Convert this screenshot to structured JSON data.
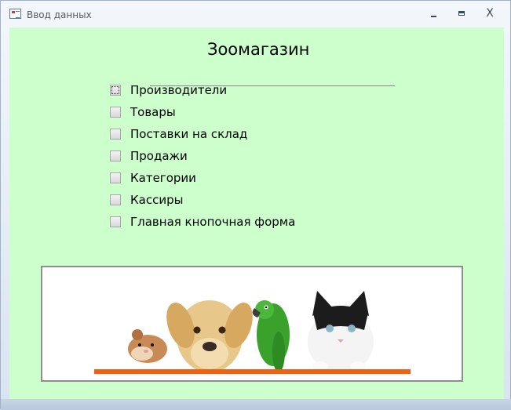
{
  "window": {
    "title": "Ввод данных",
    "minimize_glyph": "minimize-icon",
    "maximize_glyph": "maximize-icon",
    "close_label": "X"
  },
  "form": {
    "heading": "Зоомагазин",
    "background": "#ccffcc",
    "items": [
      {
        "label": "Производители"
      },
      {
        "label": "Товары"
      },
      {
        "label": "Поставки на склад"
      },
      {
        "label": "Продажи"
      },
      {
        "label": "Категории"
      },
      {
        "label": "Кассиры"
      },
      {
        "label": "Главная кнопочная форма"
      }
    ]
  },
  "picture": {
    "subjects": [
      "hamster-icon",
      "puppy-icon",
      "parrot-icon",
      "kitten-icon"
    ],
    "bar_color": "#f06010"
  }
}
